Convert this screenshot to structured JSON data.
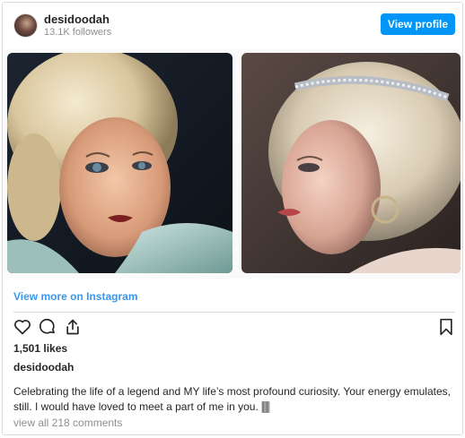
{
  "header": {
    "username": "desidoodah",
    "followers": "13.1K followers",
    "view_profile_label": "View profile"
  },
  "media": {
    "photos": [
      {
        "description": "vintage-portrait-blonde-curls"
      },
      {
        "description": "portrait-with-headband-profile"
      }
    ]
  },
  "links": {
    "view_more": "View more on Instagram"
  },
  "actions": {
    "icons": [
      "heart-icon",
      "comment-icon",
      "share-icon",
      "bookmark-icon"
    ]
  },
  "post": {
    "likes": "1,501 likes",
    "caption_user": "desidoodah",
    "caption": "Celebrating the life of a legend and MY life’s most profound curiosity. Your energy emulates, still. I would have loved to meet a part of me in you. 🀫",
    "comments_link": "view all 218 comments"
  },
  "colors": {
    "accent": "#0095f6",
    "link": "#3897f0",
    "muted": "#8e8e8e",
    "border": "#dbdbdb"
  }
}
